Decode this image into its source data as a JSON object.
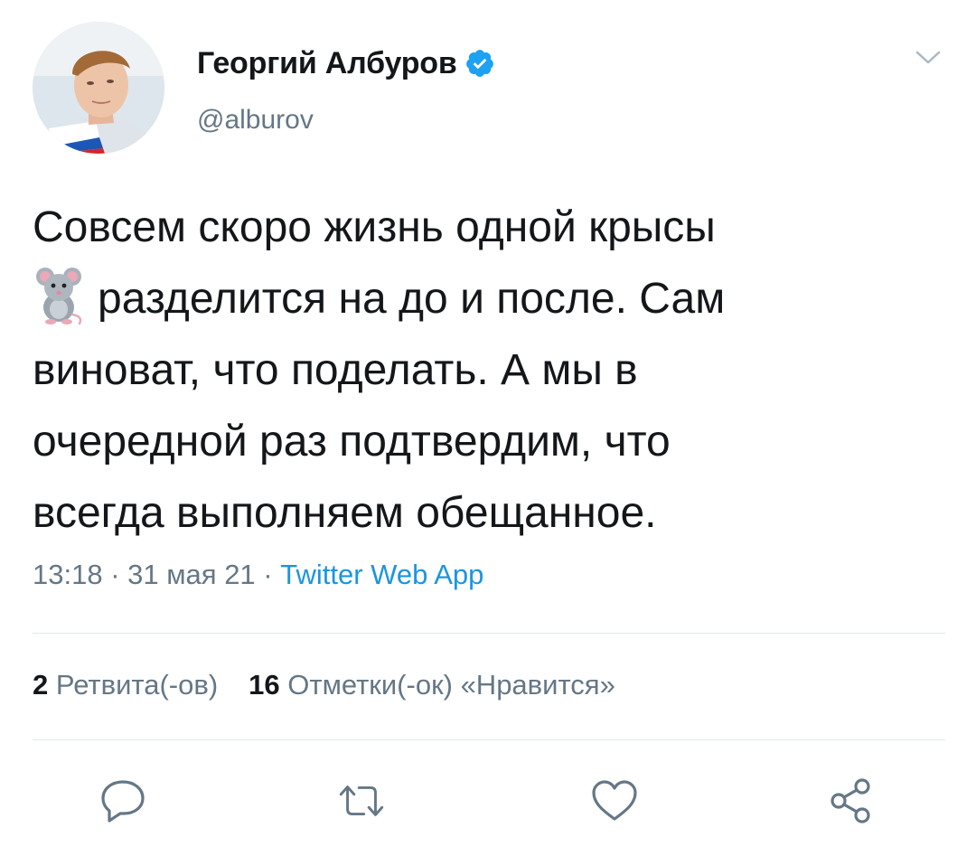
{
  "author": {
    "display_name": "Георгий Албуров",
    "handle": "@alburov",
    "verified": true,
    "verified_color": "#1da1f2",
    "avatar_icon": "user-avatar-photo"
  },
  "tweet": {
    "line_1": "Совсем скоро жизнь одной крысы",
    "emoji": "rat-emoji",
    "line_2": "разделится на до и после. Сам",
    "line_3": "виноват, что поделать. А мы в",
    "line_4": "очередной раз подтвердим, что",
    "line_5": "всегда выполняем обещанное."
  },
  "meta": {
    "time": "13:18",
    "separator_1": " · ",
    "date": "31 мая 21",
    "separator_2": " · ",
    "source": "Twitter Web App",
    "source_color": "#1b95e0"
  },
  "stats": {
    "retweets_count": "2",
    "retweets_label": "Ретвита(-ов)",
    "likes_count": "16",
    "likes_label": "Отметки(-ок) «Нравится»"
  },
  "actions": {
    "reply_icon": "reply-icon",
    "retweet_icon": "retweet-icon",
    "like_icon": "heart-icon",
    "share_icon": "share-icon",
    "icon_color": "#657786"
  }
}
